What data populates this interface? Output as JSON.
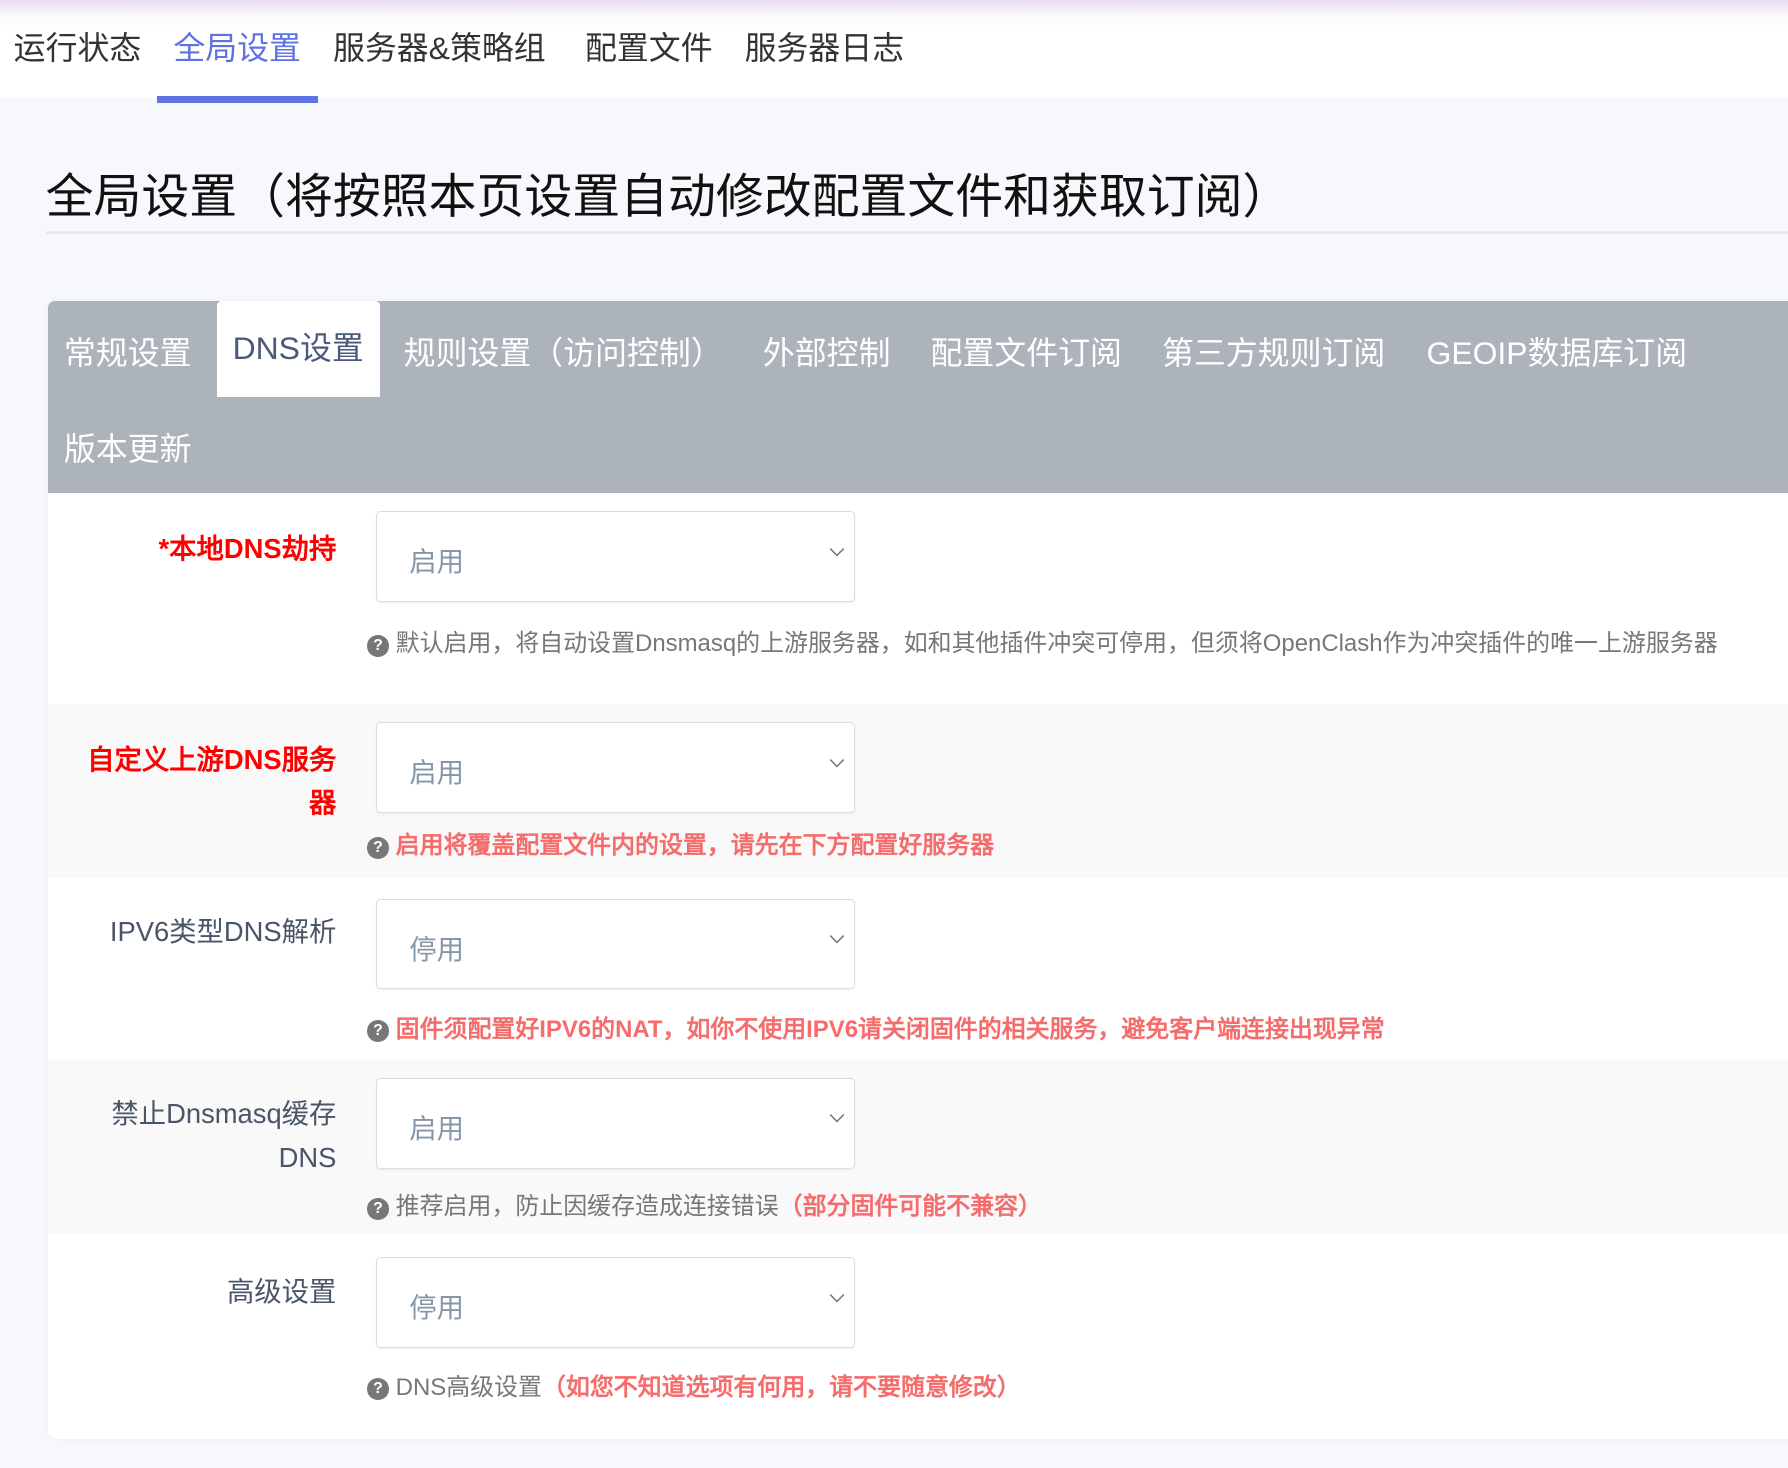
{
  "nav": {
    "items": [
      "运行状态",
      "全局设置",
      "服务器&策略组",
      "配置文件",
      "服务器日志"
    ],
    "active": 1,
    "accent": "#5e72e4"
  },
  "page_title": "全局设置（将按照本页设置自动修改配置文件和获取订阅）",
  "tabs": {
    "items": [
      "常规设置",
      "DNS设置",
      "规则设置（访问控制）",
      "外部控制",
      "配置文件订阅",
      "第三方规则订阅",
      "GEOIP数据库订阅",
      "版本更新"
    ],
    "active": 1
  },
  "rows": [
    {
      "label": "*本地DNS劫持",
      "value": "启用",
      "help": "默认启用，将自动设置Dnsmasq的上游服务器，如和其他插件冲突可停用，但须将OpenClash作为冲突插件的唯一上游服务器",
      "help_red": ""
    },
    {
      "label": "自定义上游DNS服务器",
      "value": "启用",
      "help": "",
      "help_red": "启用将覆盖配置文件内的设置，请先在下方配置好服务器"
    },
    {
      "label": "IPV6类型DNS解析",
      "value": "停用",
      "help": "",
      "help_red": "固件须配置好IPV6的NAT，如你不使用IPV6请关闭固件的相关服务，避免客户端连接出现异常"
    },
    {
      "label": "禁止Dnsmasq缓存DNS",
      "value": "启用",
      "help": "推荐启用，防止因缓存造成连接错误",
      "help_red": "（部分固件可能不兼容）"
    },
    {
      "label": "高级设置",
      "value": "停用",
      "help": "DNS高级设置",
      "help_red": "（如您不知道选项有何用，请不要随意修改）"
    }
  ]
}
